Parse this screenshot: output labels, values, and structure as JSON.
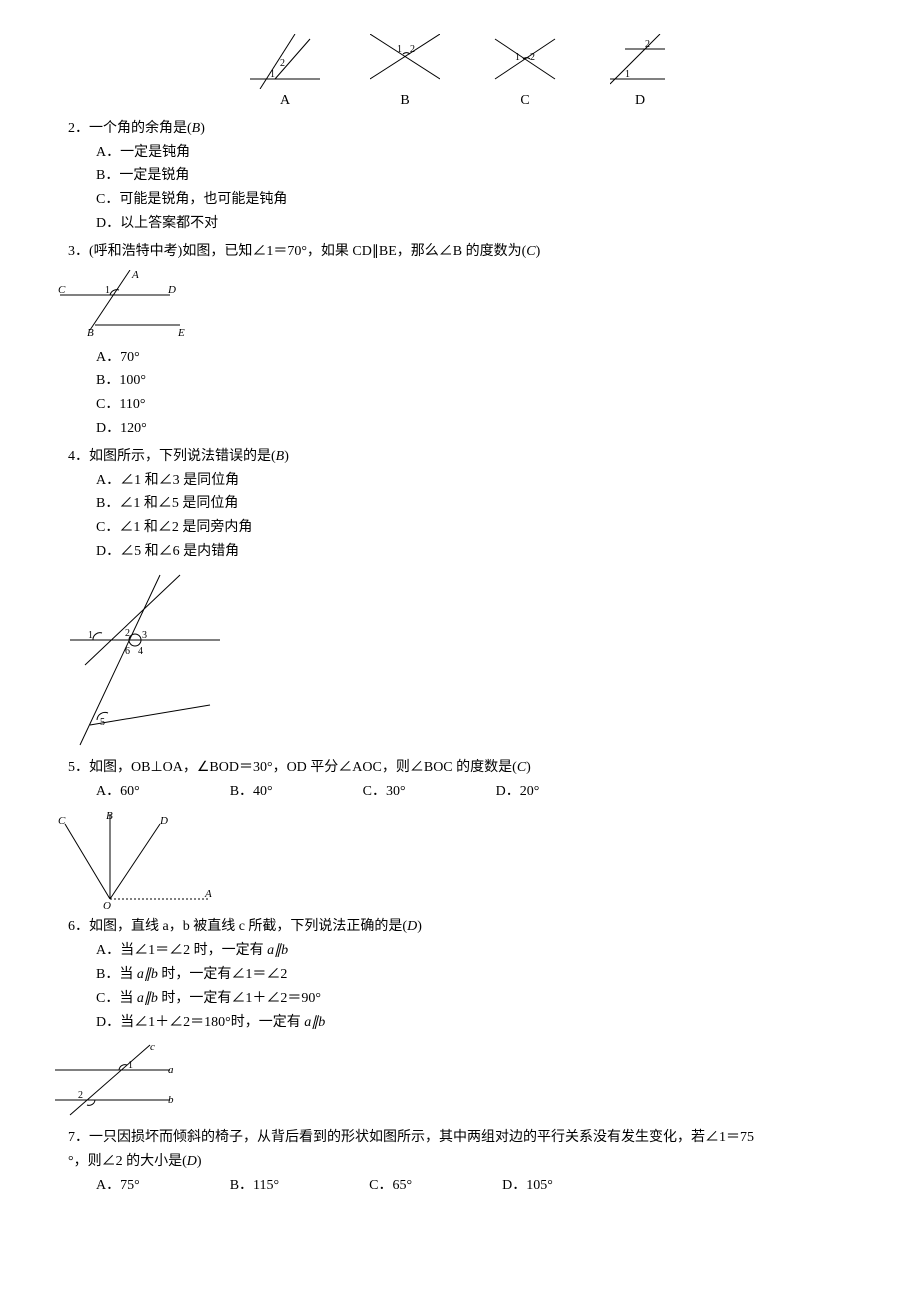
{
  "fig1": {
    "labels": [
      "A",
      "B",
      "C",
      "D"
    ]
  },
  "q2": {
    "num": "2．",
    "stem_a": "一个角的余角是(",
    "ans": "B",
    "stem_b": ")",
    "A": "A．一定是钝角",
    "B": "B．一定是锐角",
    "C": "C．可能是锐角，也可能是钝角",
    "D": "D．以上答案都不对"
  },
  "q3": {
    "num": "3．",
    "stem_a": "(呼和浩特中考)如图，已知∠1＝70°，如果 CD∥BE，那么∠B 的度数为(",
    "ans": "C",
    "stem_b": ")",
    "A": "A．70°",
    "B": "B．100°",
    "C": "C．110°",
    "D": "D．120°"
  },
  "q4": {
    "num": "4．",
    "stem_a": "如图所示，下列说法错误的是(",
    "ans": "B",
    "stem_b": ")",
    "A": "A．∠1 和∠3 是同位角",
    "B": "B．∠1 和∠5 是同位角",
    "C": "C．∠1 和∠2 是同旁内角",
    "D": "D．∠5 和∠6 是内错角"
  },
  "q5": {
    "num": "5．",
    "stem_a": "如图，OB⊥OA，∠BOD＝30°，OD 平分∠AOC，则∠BOC 的度数是(",
    "ans": "C",
    "stem_b": ")",
    "A": "A．60°",
    "B": "B．40°",
    "C": "C．30°",
    "D": "D．20°"
  },
  "q6": {
    "num": "6．",
    "stem_a": "如图，直线 a，b 被直线 c 所截，下列说法正确的是(",
    "ans": "D",
    "stem_b": ")",
    "A_pre": "A．当∠1＝∠2 时，一定有 ",
    "A_it": "a∥b",
    "B_pre": "B．当 ",
    "B_it": "a∥b",
    "B_post": " 时，一定有∠1＝∠2",
    "C_pre": "C．当 ",
    "C_it": "a∥b",
    "C_post": " 时，一定有∠1＋∠2＝90°",
    "D_pre": "D．当∠1＋∠2＝180°时，一定有 ",
    "D_it": "a∥b"
  },
  "q7": {
    "num": "7．",
    "stem1": "一只因损坏而倾斜的椅子，从背后看到的形状如图所示，其中两组对边的平行关系没有发生变化，若∠1＝75",
    "stem2a": "°，则∠2 的大小是(",
    "ans": "D",
    "stem2b": ")",
    "A": "A．75°",
    "B": "B．115°",
    "C": "C．65°",
    "D": "D．105°"
  }
}
